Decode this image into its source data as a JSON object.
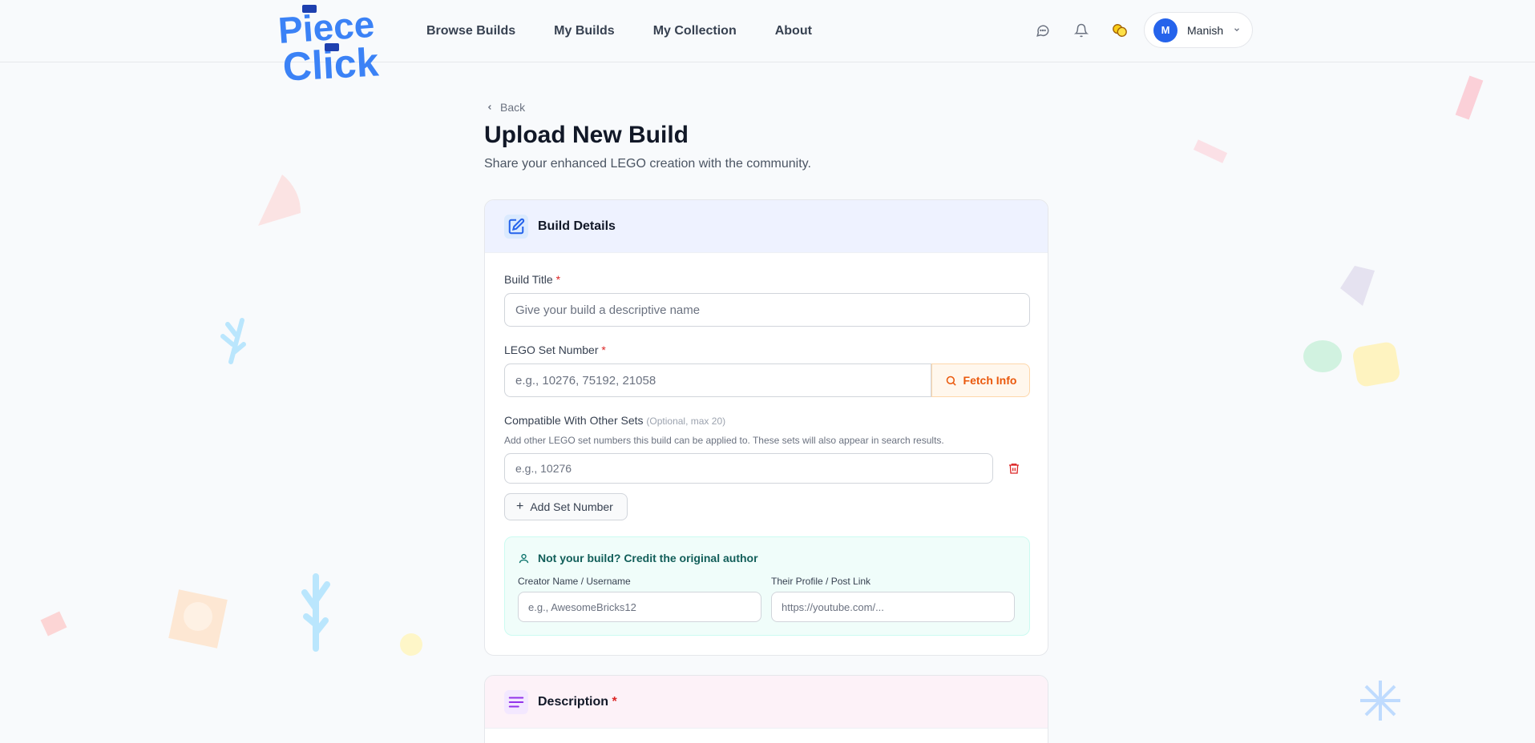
{
  "brand": {
    "logo_line1": "Piece",
    "logo_line2": "Click"
  },
  "nav": {
    "items": [
      "Browse Builds",
      "My Builds",
      "My Collection",
      "About"
    ]
  },
  "user": {
    "initial": "M",
    "name": "Manish"
  },
  "back_label": "Back",
  "page": {
    "title": "Upload New Build",
    "subtitle": "Share your enhanced LEGO creation with the community."
  },
  "build_details": {
    "heading": "Build Details",
    "title_label": "Build Title",
    "title_placeholder": "Give your build a descriptive name",
    "set_label": "LEGO Set Number",
    "set_placeholder": "e.g., 10276, 75192, 21058",
    "fetch_label": "Fetch Info",
    "compat_label": "Compatible With Other Sets",
    "compat_optional": "(Optional, max 20)",
    "compat_helper": "Add other LEGO set numbers this build can be applied to. These sets will also appear in search results.",
    "compat_placeholder": "e.g., 10276",
    "add_set_label": "Add Set Number",
    "required_mark": "*"
  },
  "credit": {
    "title": "Not your build? Credit the original author",
    "creator_label": "Creator Name / Username",
    "creator_placeholder": "e.g., AwesomeBricks12",
    "link_label": "Their Profile / Post Link",
    "link_placeholder": "https://youtube.com/..."
  },
  "description": {
    "heading": "Description",
    "required_mark": "*"
  },
  "colors": {
    "primary": "#2563eb",
    "accent_orange": "#ea580c",
    "danger": "#dc2626",
    "teal": "#0f766e",
    "purple": "#9333ea"
  }
}
